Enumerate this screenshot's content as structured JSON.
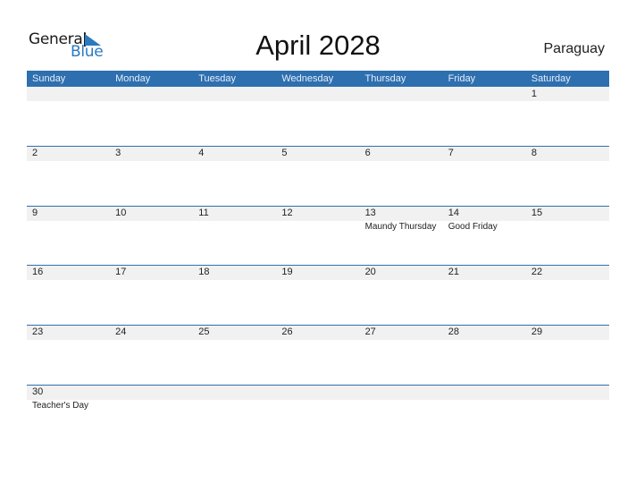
{
  "logo": {
    "line1": "General",
    "line2": "Blue"
  },
  "title": "April 2028",
  "country": "Paraguay",
  "colors": {
    "header_bg": "#2e6fb0",
    "band_bg": "#f1f1f1",
    "brand_blue": "#2a7ac0"
  },
  "weekdays": [
    "Sunday",
    "Monday",
    "Tuesday",
    "Wednesday",
    "Thursday",
    "Friday",
    "Saturday"
  ],
  "weeks": [
    [
      {
        "day": ""
      },
      {
        "day": ""
      },
      {
        "day": ""
      },
      {
        "day": ""
      },
      {
        "day": ""
      },
      {
        "day": ""
      },
      {
        "day": "1"
      }
    ],
    [
      {
        "day": "2"
      },
      {
        "day": "3"
      },
      {
        "day": "4"
      },
      {
        "day": "5"
      },
      {
        "day": "6"
      },
      {
        "day": "7"
      },
      {
        "day": "8"
      }
    ],
    [
      {
        "day": "9"
      },
      {
        "day": "10"
      },
      {
        "day": "11"
      },
      {
        "day": "12"
      },
      {
        "day": "13",
        "holiday": "Maundy Thursday"
      },
      {
        "day": "14",
        "holiday": "Good Friday"
      },
      {
        "day": "15"
      }
    ],
    [
      {
        "day": "16"
      },
      {
        "day": "17"
      },
      {
        "day": "18"
      },
      {
        "day": "19"
      },
      {
        "day": "20"
      },
      {
        "day": "21"
      },
      {
        "day": "22"
      }
    ],
    [
      {
        "day": "23"
      },
      {
        "day": "24"
      },
      {
        "day": "25"
      },
      {
        "day": "26"
      },
      {
        "day": "27"
      },
      {
        "day": "28"
      },
      {
        "day": "29"
      }
    ],
    [
      {
        "day": "30",
        "holiday": "Teacher's Day"
      },
      {
        "day": ""
      },
      {
        "day": ""
      },
      {
        "day": ""
      },
      {
        "day": ""
      },
      {
        "day": ""
      },
      {
        "day": ""
      }
    ]
  ]
}
